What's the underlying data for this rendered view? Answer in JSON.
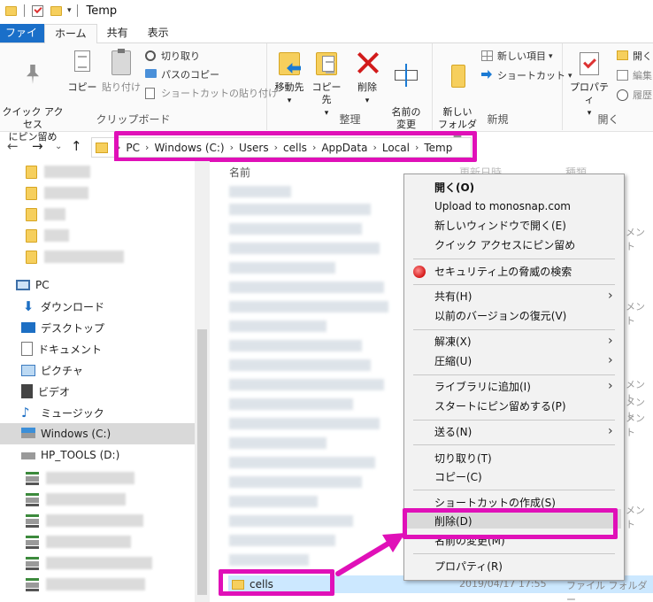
{
  "window": {
    "title": "Temp"
  },
  "ribbon_tabs": [
    "ファイル",
    "ホーム",
    "共有",
    "表示"
  ],
  "ribbon": {
    "clipboard": {
      "pin_label": "クイック アクセス\nにピン留め",
      "copy_label": "コピー",
      "paste_label": "貼り付け",
      "cut_label": "切り取り",
      "copy_path_label": "パスのコピー",
      "paste_shortcut_label": "ショートカットの貼り付け",
      "group_label": "クリップボード"
    },
    "organize": {
      "move_label": "移動先",
      "copy_to_label": "コピー先",
      "delete_label": "削除",
      "rename_label": "名前の\n変更",
      "group_label": "整理"
    },
    "new": {
      "new_folder_label": "新しい\nフォルダー",
      "new_item_label": "新しい項目",
      "shortcut_label": "ショートカット",
      "group_label": "新規"
    },
    "open": {
      "properties_label": "プロパティ",
      "open_label": "開く",
      "edit_label": "編集",
      "history_label": "履歴",
      "group_label": "開く"
    }
  },
  "breadcrumb": [
    "PC",
    "Windows (C:)",
    "Users",
    "cells",
    "AppData",
    "Local",
    "Temp"
  ],
  "nav_pane": {
    "items": [
      {
        "label": "PC",
        "icon": "pc-icon"
      },
      {
        "label": "ダウンロード",
        "icon": "download-icon"
      },
      {
        "label": "デスクトップ",
        "icon": "desktop-icon"
      },
      {
        "label": "ドキュメント",
        "icon": "documents-icon"
      },
      {
        "label": "ピクチャ",
        "icon": "pictures-icon"
      },
      {
        "label": "ビデオ",
        "icon": "videos-icon"
      },
      {
        "label": "ミュージック",
        "icon": "music-icon"
      },
      {
        "label": "Windows (C:)",
        "icon": "drive-icon"
      },
      {
        "label": "HP_TOOLS (D:)",
        "icon": "drive-icon"
      }
    ],
    "selected": "Windows (C:)"
  },
  "file_list": {
    "col_name": "名前",
    "col_date": "更新日時",
    "col_type": "種類",
    "selected_file": {
      "name": "cells",
      "date": "2019/04/17 17:55",
      "type": "ファイル フォルダー"
    },
    "right_col_text": "メント"
  },
  "context_menu": {
    "items": [
      {
        "label": "開く(O)",
        "bold": true
      },
      {
        "label": "Upload to monosnap.com"
      },
      {
        "label": "新しいウィンドウで開く(E)"
      },
      {
        "label": "クイック アクセスにピン留め"
      },
      {
        "label": "セキュリティ上の脅威の検索"
      },
      {
        "label": "共有(H)",
        "submenu": true
      },
      {
        "label": "以前のバージョンの復元(V)"
      },
      {
        "label": "解凍(X)",
        "submenu": true
      },
      {
        "label": "圧縮(U)",
        "submenu": true
      },
      {
        "label": "ライブラリに追加(I)",
        "submenu": true
      },
      {
        "label": "スタートにピン留めする(P)"
      },
      {
        "label": "送る(N)",
        "submenu": true
      },
      {
        "label": "切り取り(T)"
      },
      {
        "label": "コピー(C)"
      },
      {
        "label": "ショートカットの作成(S)"
      },
      {
        "label": "削除(D)",
        "highlighted": true
      },
      {
        "label": "名前の変更(M)"
      },
      {
        "label": "プロパティ(R)"
      }
    ]
  },
  "colors": {
    "accent": "#1a6fc9",
    "annotation": "#e010b8",
    "selection": "#cce8ff"
  }
}
